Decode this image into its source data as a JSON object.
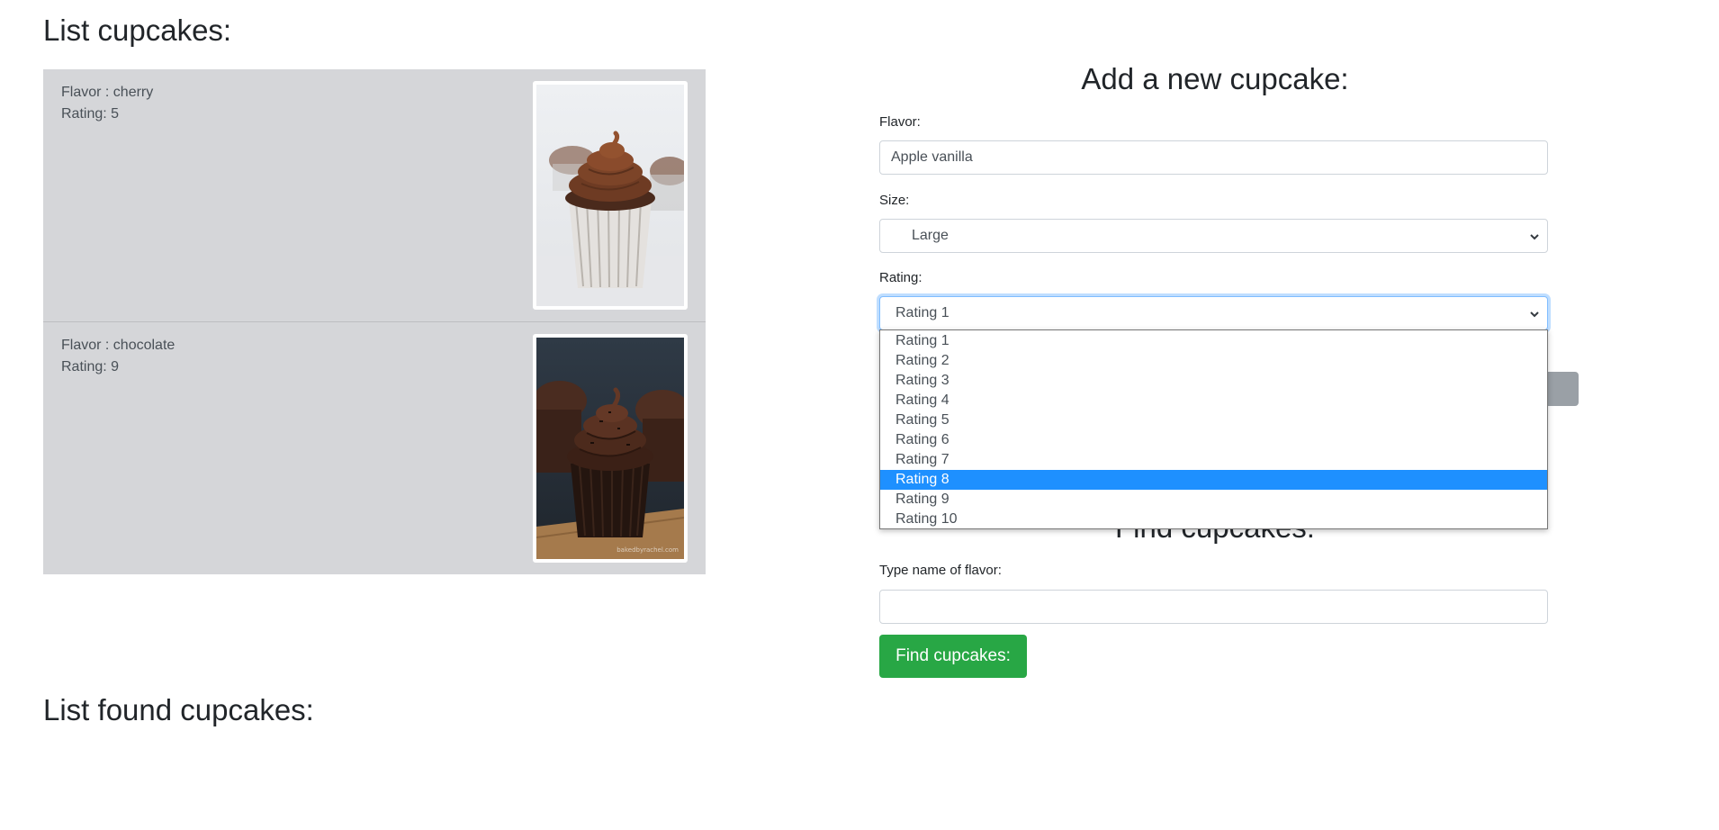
{
  "list": {
    "title": "List cupcakes:",
    "items": [
      {
        "flavor_text": "Flavor : cherry",
        "rating_text": "Rating: 5",
        "photo": "chocolate-cupcake-photo"
      },
      {
        "flavor_text": "Flavor : chocolate",
        "rating_text": "Rating: 9",
        "photo": "dark-chocolate-cupcake-photo"
      }
    ]
  },
  "found": {
    "title": "List found cupcakes:"
  },
  "add_form": {
    "title": "Add a new cupcake:",
    "flavor_label": "Flavor:",
    "flavor_value": "Apple vanilla",
    "size_label": "Size:",
    "size_value": "Large",
    "rating_label": "Rating:",
    "rating_value": "Rating 1",
    "rating_options": [
      "Rating 1",
      "Rating 2",
      "Rating 3",
      "Rating 4",
      "Rating 5",
      "Rating 6",
      "Rating 7",
      "Rating 8",
      "Rating 9",
      "Rating 10"
    ],
    "highlighted_option": "Rating 8"
  },
  "find_form": {
    "title": "Find cupcakes:",
    "label": "Type name of flavor:",
    "value": "",
    "button_label": "Find cupcakes:"
  },
  "colors": {
    "card_bg": "#d5d6d9",
    "button_green": "#28a745",
    "highlight_blue": "#1e90ff"
  }
}
